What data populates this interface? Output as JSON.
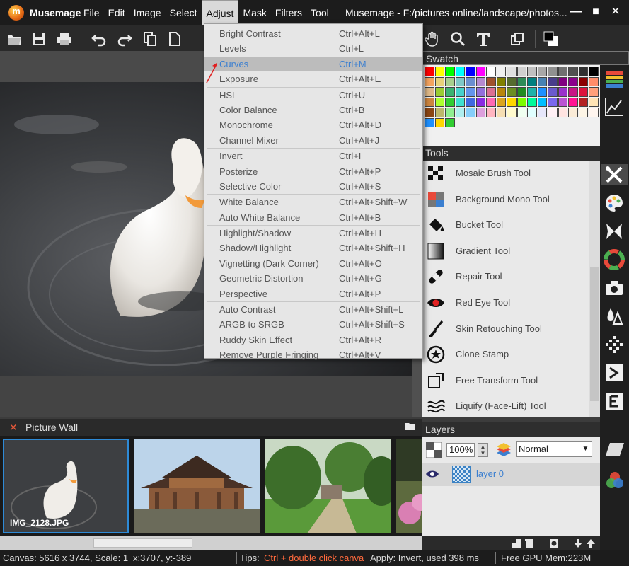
{
  "app": {
    "name": "Musemage",
    "window_title": "Musemage - F:/pictures online/landscape/photos..."
  },
  "menubar": [
    {
      "label": "File"
    },
    {
      "label": "Edit"
    },
    {
      "label": "Image"
    },
    {
      "label": "Select"
    },
    {
      "label": "Adjust",
      "active": true
    },
    {
      "label": "Mask"
    },
    {
      "label": "Filters"
    },
    {
      "label": "Tool"
    }
  ],
  "window_controls": {
    "minimize": "—",
    "maximize": "■",
    "close": "✕"
  },
  "adjust_menu": {
    "groups": [
      [
        {
          "label": "Bright Contrast",
          "shortcut": "Ctrl+Alt+L"
        },
        {
          "label": "Levels",
          "shortcut": "Ctrl+L"
        },
        {
          "label": "Curves",
          "shortcut": "Ctrl+M",
          "highlighted": true
        },
        {
          "label": "Exposure",
          "shortcut": "Ctrl+Alt+E"
        }
      ],
      [
        {
          "label": "HSL",
          "shortcut": "Ctrl+U"
        },
        {
          "label": "Color Balance",
          "shortcut": "Ctrl+B"
        },
        {
          "label": "Monochrome",
          "shortcut": "Ctrl+Alt+D"
        },
        {
          "label": "Channel Mixer",
          "shortcut": "Ctrl+Alt+J"
        }
      ],
      [
        {
          "label": "Invert",
          "shortcut": "Ctrl+I"
        },
        {
          "label": "Posterize",
          "shortcut": "Ctrl+Alt+P"
        },
        {
          "label": "Selective Color",
          "shortcut": "Ctrl+Alt+S"
        }
      ],
      [
        {
          "label": "White Balance",
          "shortcut": "Ctrl+Alt+Shift+W"
        },
        {
          "label": "Auto White Balance",
          "shortcut": "Ctrl+Alt+B"
        }
      ],
      [
        {
          "label": "Highlight/Shadow",
          "shortcut": "Ctrl+Alt+H"
        },
        {
          "label": "Shadow/Highlight",
          "shortcut": "Ctrl+Alt+Shift+H"
        },
        {
          "label": "Vignetting (Dark Corner)",
          "shortcut": "Ctrl+Alt+O"
        },
        {
          "label": "Geometric Distortion",
          "shortcut": "Ctrl+Alt+G"
        },
        {
          "label": "Perspective",
          "shortcut": "Ctrl+Alt+P"
        }
      ],
      [
        {
          "label": "Auto Contrast",
          "shortcut": "Ctrl+Alt+Shift+L"
        },
        {
          "label": "ARGB to SRGB",
          "shortcut": "Ctrl+Alt+Shift+S"
        },
        {
          "label": "Ruddy Skin Effect",
          "shortcut": "Ctrl+Alt+R"
        },
        {
          "label": "Remove Purple Fringing",
          "shortcut": "Ctrl+Alt+V"
        }
      ]
    ]
  },
  "panels": {
    "swatch_title": "Swatch",
    "tools_title": "Tools",
    "layers_title": "Layers",
    "picture_wall_title": "Picture Wall"
  },
  "swatch_colors": [
    "#ff0000",
    "#ffff00",
    "#00ff00",
    "#00ffff",
    "#0000ff",
    "#ff00ff",
    "#ffffff",
    "#f0f0f0",
    "#e0e0e0",
    "#d0d0d0",
    "#c0c0c0",
    "#a8a8a8",
    "#909090",
    "#707070",
    "#505050",
    "#303030",
    "#000000",
    "#f4a460",
    "#e8d27a",
    "#a8d08d",
    "#7fc8c8",
    "#6a8fd0",
    "#b58ad0",
    "#a0522d",
    "#808000",
    "#556b2f",
    "#2e8b57",
    "#008080",
    "#4682b4",
    "#483d8b",
    "#800080",
    "#8b008b",
    "#8b0000",
    "#ff8c69",
    "#deb887",
    "#9acd32",
    "#3cb371",
    "#48d1cc",
    "#6495ed",
    "#9370db",
    "#db7093",
    "#b8860b",
    "#6b8e23",
    "#228b22",
    "#20b2aa",
    "#1e90ff",
    "#6a5acd",
    "#9932cc",
    "#c71585",
    "#dc143c",
    "#ffa07a",
    "#cd853f",
    "#adff2f",
    "#32cd32",
    "#40e0d0",
    "#4169e1",
    "#8a2be2",
    "#ff69b4",
    "#daa520",
    "#ffd700",
    "#7cfc00",
    "#00fa9a",
    "#00bfff",
    "#7b68ee",
    "#ba55d3",
    "#ff1493",
    "#b22222",
    "#ffe4b5",
    "#8b4513",
    "#bdb76b",
    "#90ee90",
    "#afeeee",
    "#87cefa",
    "#dda0dd",
    "#ffb6c1",
    "#f5deb3",
    "#fffacd",
    "#f0fff0",
    "#e0ffff",
    "#e6e6fa",
    "#fff0f5",
    "#ffe4e1",
    "#faebd7",
    "#fdf5e6",
    "#fff5ee",
    "#1e90ff",
    "#ffd700",
    "#32cd32"
  ],
  "tools": [
    {
      "label": "Mosaic Brush Tool",
      "icon": "mosaic-icon"
    },
    {
      "label": "Background Mono Tool",
      "icon": "background-mono-icon"
    },
    {
      "label": "Bucket Tool",
      "icon": "bucket-icon"
    },
    {
      "label": "Gradient Tool",
      "icon": "gradient-icon"
    },
    {
      "label": "Repair Tool",
      "icon": "bandage-icon"
    },
    {
      "label": "Red Eye Tool",
      "icon": "eye-icon"
    },
    {
      "label": "Skin Retouching Tool",
      "icon": "brush-icon"
    },
    {
      "label": "Clone Stamp",
      "icon": "star-stamp-icon"
    },
    {
      "label": "Free Transform Tool",
      "icon": "transform-icon"
    },
    {
      "label": "Liquify (Face-Lift) Tool",
      "icon": "liquify-icon"
    }
  ],
  "picture_wall": {
    "thumbnails": [
      {
        "name": "IMG_2128.JPG",
        "selected": true
      },
      {
        "name": ""
      },
      {
        "name": ""
      },
      {
        "name": ""
      }
    ]
  },
  "layers": {
    "opacity": "100%",
    "blend_mode": "Normal",
    "items": [
      {
        "name": "layer 0"
      }
    ]
  },
  "statusbar": {
    "canvas": "Canvas: 5616 x 3744, Scale: 1",
    "coords": "x:3707, y:-389",
    "tips_label": "Tips:",
    "tips_text": "Ctrl + double click canva",
    "apply": "Apply: Invert, used 398 ms",
    "gpu": "Free GPU Mem:223M"
  },
  "colors": {
    "accent": "#3b7fd0",
    "titlebar": "#1c1c1c",
    "menu_bg": "#e6e6e6",
    "tip_highlight": "#ff6a3d"
  }
}
